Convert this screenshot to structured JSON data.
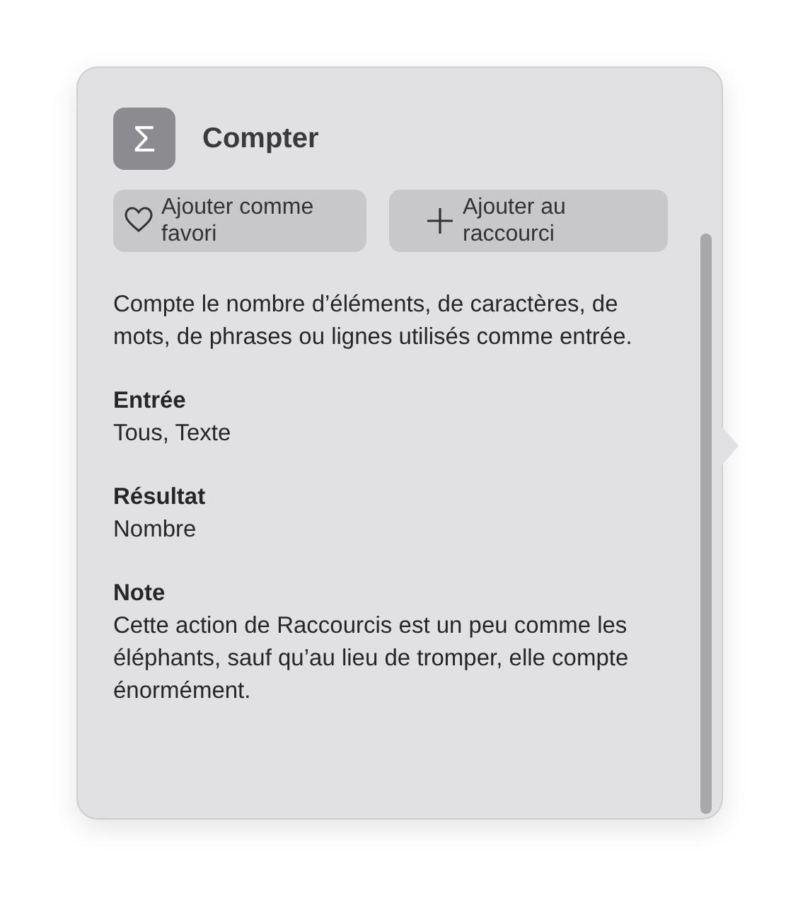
{
  "header": {
    "title": "Compter",
    "icon": "Σ"
  },
  "buttons": [
    {
      "kind": "favorite",
      "label": "Ajouter comme favori"
    },
    {
      "kind": "add",
      "label": "Ajouter au raccourci"
    }
  ],
  "description": "Compte le nombre d’éléments, de caractères, de mots, de phrases ou lignes utilisés comme entrée.",
  "sections": [
    {
      "heading": "Entrée",
      "text": "Tous, Texte"
    },
    {
      "heading": "Résultat",
      "text": "Nombre"
    },
    {
      "heading": "Note",
      "text": "Cette action de Raccourcis est un peu comme les éléphants, sauf qu’au lieu de tromper, elle compte énormément."
    }
  ]
}
